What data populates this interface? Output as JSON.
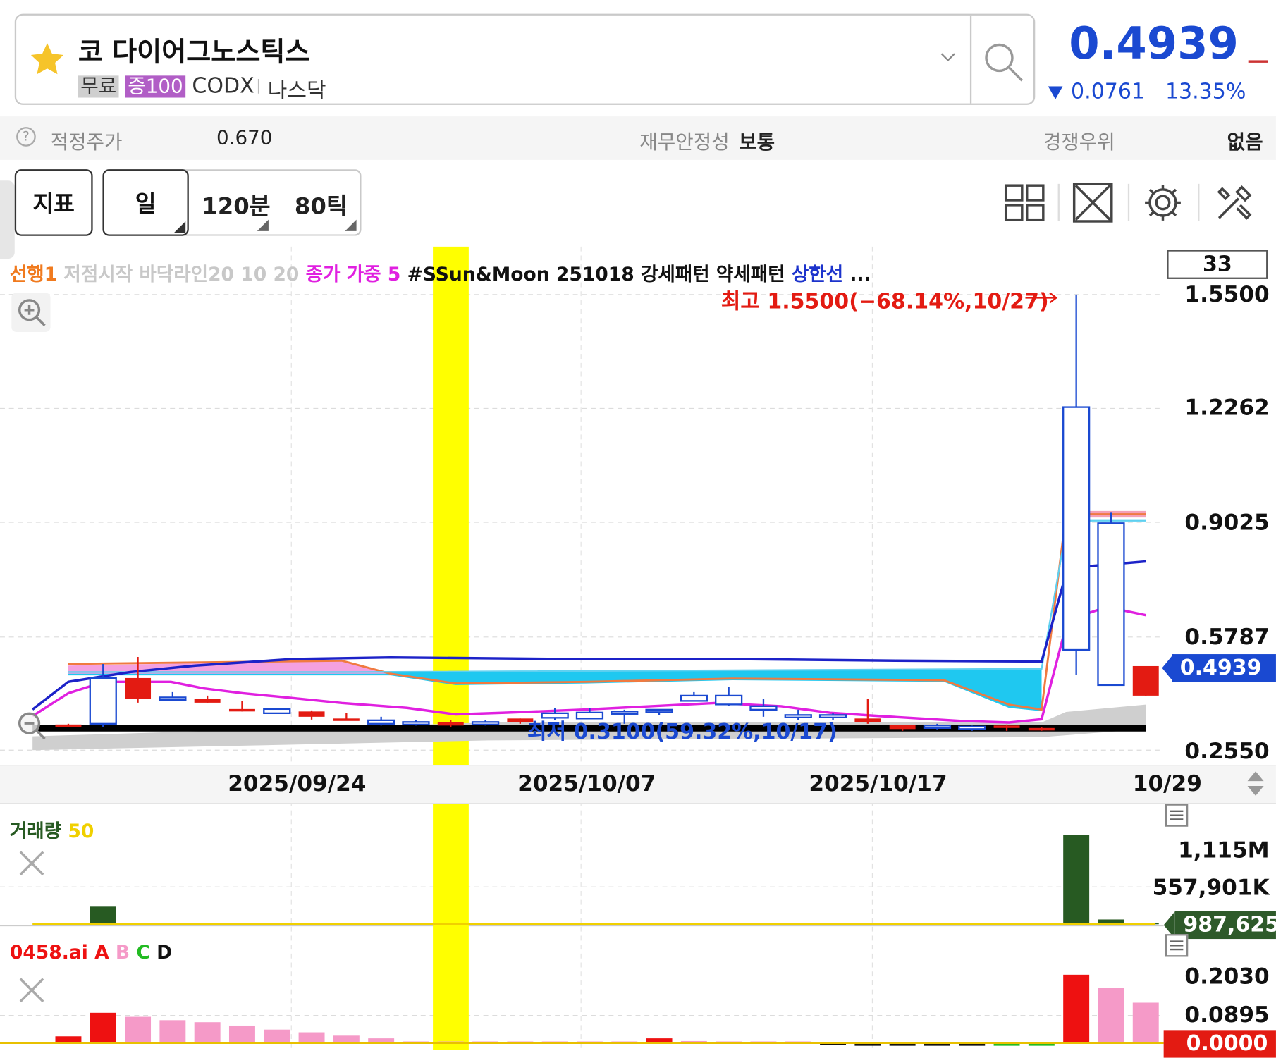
{
  "header": {
    "stock_name": "코 다이어그노스틱스",
    "badges": {
      "free": "무료",
      "margin": "증100"
    },
    "ticker": "CODX",
    "market": "나스닥",
    "price": "0.4939",
    "change": "0.0761",
    "change_pct": "13.35%",
    "colors": {
      "down": "#1a49d1",
      "badge_free": "#cfcfcf",
      "badge_margin": "#b15ec6"
    }
  },
  "info": {
    "fair_price_label": "적정주가",
    "fair_price_value": "0.670",
    "stability_label": "재무안정성",
    "stability_value": "보통",
    "advantage_label": "경쟁우위",
    "advantage_value": "없음"
  },
  "toolbar": {
    "indicator": "지표",
    "period_day": "일",
    "period_120min": "120분",
    "period_80tick": "80틱",
    "icons": [
      "layout-grid-icon",
      "expand-icon",
      "gear-icon",
      "tools-icon"
    ]
  },
  "chart_legend": {
    "item1": "선행1",
    "item2": "저점시작 바닥라인20 10 20",
    "item3": "종가 가중 5",
    "item4": "#SSun&Moon 251018 강세패턴 약세패턴",
    "item5": "상한선",
    "more": "...",
    "colors": {
      "item1": "#f07a1e",
      "item2": "#c8c8c8",
      "item3": "#e020e0",
      "item4": "#111111",
      "item5": "#1c33cc"
    }
  },
  "chart_box_value": "33",
  "price_axis": [
    "1.5500",
    "1.2262",
    "0.9025",
    "0.5787",
    "0.2550"
  ],
  "current_price_tag": "0.4939",
  "annotations": {
    "high": "최고 1.5500(−68.14%,10/27)",
    "low": "최저 0.3100(59.32%,10/17)"
  },
  "date_axis": [
    "2025/09/24",
    "2025/10/07",
    "2025/10/17",
    "10/29"
  ],
  "volume_panel": {
    "title": "거래량",
    "period": "50",
    "axis": [
      "1,115M",
      "557,901K"
    ],
    "current_tag": "987,625",
    "colors": {
      "bar": "#275a22",
      "ma": "#f0d000",
      "tag": "#2e5a2a"
    }
  },
  "ai_panel": {
    "title": "0458.ai",
    "labels": [
      "A",
      "B",
      "C",
      "D"
    ],
    "label_colors": [
      "#ee1111",
      "#f59ac8",
      "#22bb22",
      "#111111"
    ],
    "axis": [
      "0.2030",
      "0.0895"
    ],
    "current_tag": "0.0000"
  },
  "chart_data": [
    {
      "type": "candlestick",
      "x": [
        "09/16",
        "09/17",
        "09/18",
        "09/19",
        "09/22",
        "09/23",
        "09/24",
        "09/25",
        "09/26",
        "09/29",
        "09/30",
        "10/01",
        "10/02",
        "10/03",
        "10/06",
        "10/07",
        "10/08",
        "10/09",
        "10/10",
        "10/13",
        "10/14",
        "10/15",
        "10/16",
        "10/17",
        "10/20",
        "10/21",
        "10/22",
        "10/23",
        "10/24",
        "10/27",
        "10/28",
        "10/29"
      ],
      "open": [
        0.325,
        0.46,
        0.4,
        0.405,
        0.39,
        0.37,
        0.372,
        0.35,
        0.345,
        0.34,
        0.335,
        0.325,
        0.335,
        0.335,
        0.36,
        0.362,
        0.365,
        0.37,
        0.41,
        0.41,
        0.38,
        0.355,
        0.355,
        0.335,
        0.315,
        0.325,
        0.322,
        0.32,
        0.315,
        1.23,
        0.9,
        0.41
      ],
      "high": [
        0.33,
        0.5,
        0.52,
        0.42,
        0.41,
        0.395,
        0.375,
        0.368,
        0.36,
        0.35,
        0.34,
        0.34,
        0.34,
        0.345,
        0.375,
        0.375,
        0.37,
        0.37,
        0.42,
        0.435,
        0.4,
        0.37,
        0.36,
        0.4,
        0.32,
        0.33,
        0.325,
        0.328,
        0.32,
        1.55,
        0.93,
        0.48
      ],
      "low": [
        0.32,
        0.32,
        0.39,
        0.4,
        0.39,
        0.365,
        0.36,
        0.342,
        0.34,
        0.325,
        0.325,
        0.32,
        0.325,
        0.33,
        0.34,
        0.355,
        0.33,
        0.355,
        0.395,
        0.38,
        0.35,
        0.34,
        0.34,
        0.33,
        0.31,
        0.314,
        0.31,
        0.31,
        0.31,
        0.47,
        0.55,
        0.41
      ],
      "close": [
        0.328,
        0.33,
        0.46,
        0.4,
        0.4,
        0.372,
        0.36,
        0.365,
        0.345,
        0.33,
        0.328,
        0.335,
        0.332,
        0.345,
        0.347,
        0.345,
        0.364,
        0.367,
        0.395,
        0.385,
        0.37,
        0.35,
        0.348,
        0.345,
        0.326,
        0.318,
        0.315,
        0.325,
        0.318,
        0.54,
        0.44,
        0.494
      ],
      "ylim": [
        0.255,
        1.55
      ],
      "high_marker": 1.55,
      "low_marker": 0.31
    },
    {
      "type": "bar",
      "name": "거래량",
      "x": [
        "09/16",
        "09/17",
        "09/18",
        "09/19",
        "09/22",
        "09/23",
        "09/24",
        "09/25",
        "09/26",
        "09/29",
        "09/30",
        "10/01",
        "10/02",
        "10/03",
        "10/06",
        "10/07",
        "10/08",
        "10/09",
        "10/10",
        "10/13",
        "10/14",
        "10/15",
        "10/16",
        "10/17",
        "10/20",
        "10/21",
        "10/22",
        "10/23",
        "10/24",
        "10/27",
        "10/28",
        "10/29"
      ],
      "values": [
        2,
        220,
        8,
        4,
        3,
        3,
        2,
        2,
        2,
        2,
        2,
        2,
        2,
        2,
        2,
        2,
        2,
        2,
        2,
        2,
        2,
        2,
        2,
        2,
        2,
        2,
        2,
        2,
        2,
        1115,
        60,
        12
      ],
      "unit": "M",
      "ylim": [
        0,
        1200
      ]
    },
    {
      "type": "bar",
      "name": "0458.ai",
      "x": [
        "09/16",
        "09/17",
        "09/18",
        "09/19",
        "09/22",
        "09/23",
        "09/24",
        "09/25",
        "09/26",
        "09/29",
        "09/30",
        "10/01",
        "10/02",
        "10/03",
        "10/06",
        "10/07",
        "10/08",
        "10/09",
        "10/10",
        "10/13",
        "10/14",
        "10/15",
        "10/16",
        "10/17",
        "10/20",
        "10/21",
        "10/22",
        "10/23",
        "10/24",
        "10/27",
        "10/28",
        "10/29"
      ],
      "values": [
        0.02,
        0.09,
        0.078,
        0.068,
        0.062,
        0.052,
        0.04,
        0.032,
        0.022,
        0.014,
        0.004,
        0.002,
        0.002,
        0.001,
        0.001,
        0.002,
        0.002,
        0.014,
        0.006,
        0.004,
        0.002,
        0.002,
        -0.004,
        -0.008,
        -0.008,
        -0.008,
        -0.008,
        -0.008,
        -0.008,
        0.203,
        0.165,
        0.12
      ],
      "ylim": [
        -0.02,
        0.22
      ]
    }
  ]
}
